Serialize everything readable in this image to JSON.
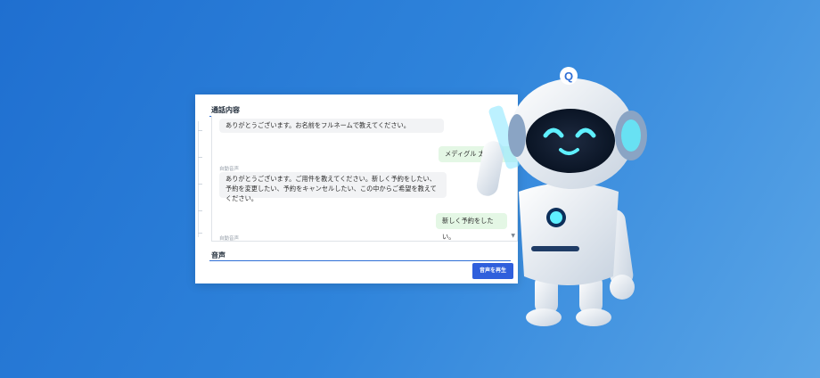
{
  "panel": {
    "conversation_title": "通話内容",
    "audio_title": "音声",
    "play_button_label": "音声を再生"
  },
  "messages": [
    {
      "role": "bot",
      "text": "ありがとうございます。お名前をフルネームで教えてください。"
    },
    {
      "role": "user",
      "text": "メディグル 太郎"
    },
    {
      "role": "bot",
      "label": "自動音声",
      "text": "ありがとうございます。ご用件を教えてください。新しく予約をしたい、予約を変更したい、予約をキャンセルしたい、この中からご希望を教えてください。"
    },
    {
      "role": "user",
      "text": "新しく予約をしたい。"
    },
    {
      "role": "bot",
      "label": "自動音声"
    }
  ],
  "colors": {
    "bg_start": "#1f6fd0",
    "bg_end": "#5aa5e6",
    "accent": "#2f5fdc",
    "user_bubble": "#e4f7e5",
    "bot_bubble": "#f2f3f5",
    "robot_face_glow": "#5ff0ff"
  },
  "robot": {
    "icon": "robot-mascot-icon",
    "badge_glyph": "Q"
  }
}
